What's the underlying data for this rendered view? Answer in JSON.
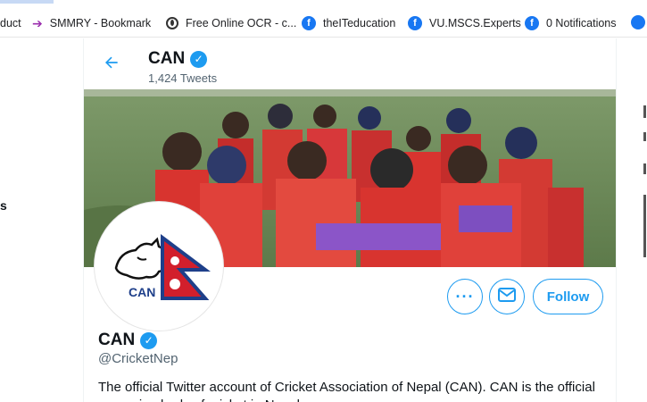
{
  "browser": {
    "bookmarks": [
      {
        "label": "duct",
        "icon": "none"
      },
      {
        "label": "SMMRY - Bookmark",
        "icon": "arrow-icon"
      },
      {
        "label": "Free Online OCR - c...",
        "icon": "ocr-icon"
      },
      {
        "label": "theITeducation",
        "icon": "facebook-icon"
      },
      {
        "label": "VU.MSCS.Experts",
        "icon": "facebook-icon"
      },
      {
        "label": "0 Notifications",
        "icon": "facebook-icon"
      }
    ]
  },
  "sidebar_left": {
    "fragment": "s"
  },
  "profile_header": {
    "back_icon": "arrow-left-icon",
    "name": "CAN",
    "tweet_count": "1,424 Tweets"
  },
  "avatar": {
    "logo_text": "CAN"
  },
  "actions": {
    "more_icon": "ellipsis-icon",
    "message_icon": "envelope-icon",
    "follow_label": "Follow"
  },
  "profile": {
    "name": "CAN",
    "handle": "@CricketNep",
    "bio": "The official Twitter account of Cricket Association of Nepal (CAN). CAN is the official governing body of cricket in Nepal."
  },
  "colors": {
    "accent": "#1d9bf0",
    "text": "#0f1419",
    "secondary": "#536471",
    "facebook": "#1877f2"
  }
}
